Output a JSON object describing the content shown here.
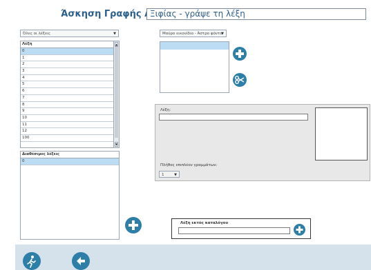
{
  "header": {
    "title_label": "Άσκηση Γραφής Λέξης:",
    "title_value": "Ξιφίας - γράψε τη λέξη"
  },
  "words_filter": {
    "selected": "Όλες οι λέξεις"
  },
  "word_list": {
    "header": "Λέξη",
    "rows": [
      "0",
      "1",
      "2",
      "3",
      "4",
      "5",
      "6",
      "7",
      "8",
      "9",
      "10",
      "11",
      "12",
      "100"
    ],
    "selected_index": 0
  },
  "available_words": {
    "header": "Διαθέσιμες λέξεις",
    "rows": [
      "0"
    ]
  },
  "image_category": {
    "selected": "Μαύρο εικονίδιο - Άστρο φόντο"
  },
  "word_panel": {
    "word_label": "Λέξη:",
    "extra_letters_label": "Πλήθος επιπλέον γραμμάτων:",
    "extra_letters_value": "1"
  },
  "offlist": {
    "title": "Λέξη εκτός καταλόγου"
  },
  "colors": {
    "accent": "#2e7fa8",
    "selection": "#bcdcf4",
    "footer": "#d5e2ec"
  },
  "icons": [
    "plus-icon",
    "scissors-icon",
    "runner-icon",
    "back-arrow-icon"
  ]
}
